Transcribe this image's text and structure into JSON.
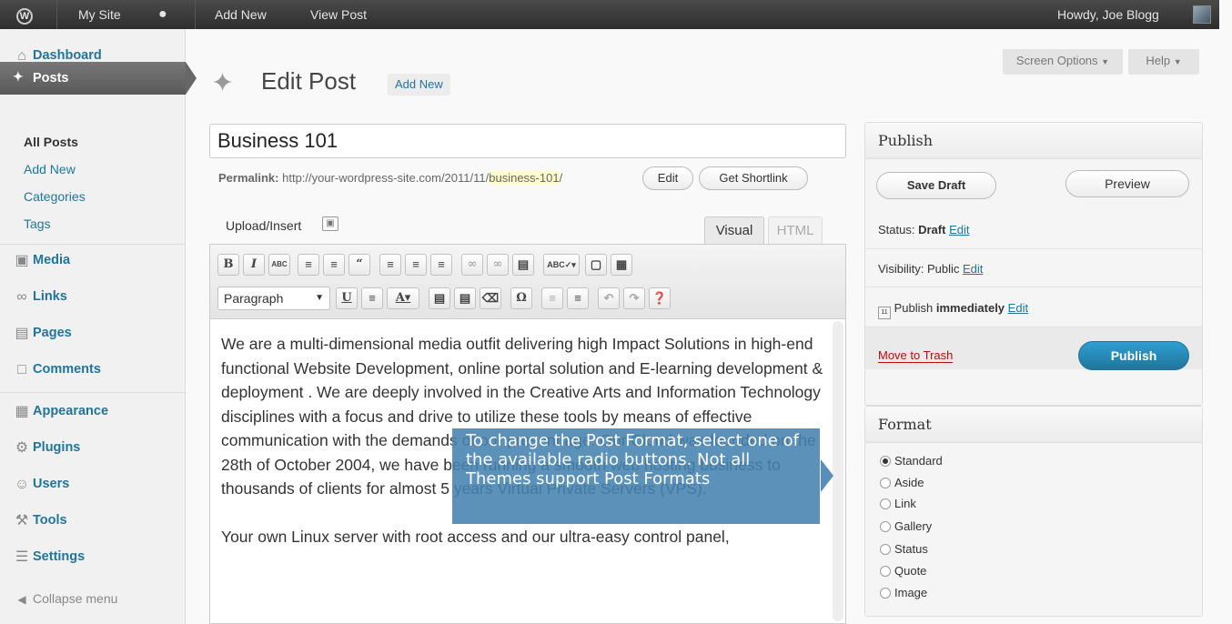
{
  "adminbar": {
    "site_name": "My Site",
    "add_new": "Add New",
    "view_post": "View Post",
    "greeting": "Howdy, Joe Blogg"
  },
  "sidebar": {
    "dashboard": "Dashboard",
    "posts": "Posts",
    "submenu": [
      "All Posts",
      "Add New",
      "Categories",
      "Tags"
    ],
    "media": "Media",
    "links": "Links",
    "pages": "Pages",
    "comments": "Comments",
    "appearance": "Appearance",
    "plugins": "Plugins",
    "users": "Users",
    "tools": "Tools",
    "settings": "Settings",
    "collapse": "Collapse menu"
  },
  "header": {
    "title": "Edit Post",
    "add_new": "Add New",
    "screen_options": "Screen Options",
    "help": "Help"
  },
  "post": {
    "title": "Business 101",
    "permalink_label": "Permalink:",
    "permalink_base": "http://your-wordpress-site.com/2011/11/",
    "permalink_slug": "business-101",
    "permalink_end": "/",
    "edit_btn": "Edit",
    "shortlink_btn": "Get Shortlink",
    "upload_insert": "Upload/Insert",
    "tab_visual": "Visual",
    "tab_html": "HTML",
    "format_select": "Paragraph",
    "paragraphs": [
      "We are a multi-dimensional media outfit delivering high Impact Solutions in high-end functional Website Development, online portal solution and E-learning development & deployment . We are deeply involved in the Creative Arts and Information Technology disciplines with a focus and drive to utilize these tools by means of effective communication with the demands of our present age. Our Cloud was founded on the 28th of October 2004, we have been running a smooth web hosting business to thousands of clients for almost 5 years Virtual Private Servers (VPS).",
      "Your own Linux server with root access and our ultra-easy control panel,"
    ]
  },
  "publish": {
    "title": "Publish",
    "save_draft": "Save Draft",
    "preview": "Preview",
    "status_label": "Status:",
    "status_value": "Draft",
    "visibility_label": "Visibility:",
    "visibility_value": "Public",
    "edit": "Edit",
    "publish_label": "Publish",
    "publish_when": "immediately",
    "trash": "Move to Trash",
    "publish_btn": "Publish"
  },
  "format": {
    "title": "Format",
    "options": [
      "Standard",
      "Aside",
      "Link",
      "Gallery",
      "Status",
      "Quote",
      "Image"
    ],
    "selected": "Standard"
  },
  "tooltip": {
    "text": "To change the Post Format, select one of the available radio buttons. Not all Themes support Post Formats"
  }
}
